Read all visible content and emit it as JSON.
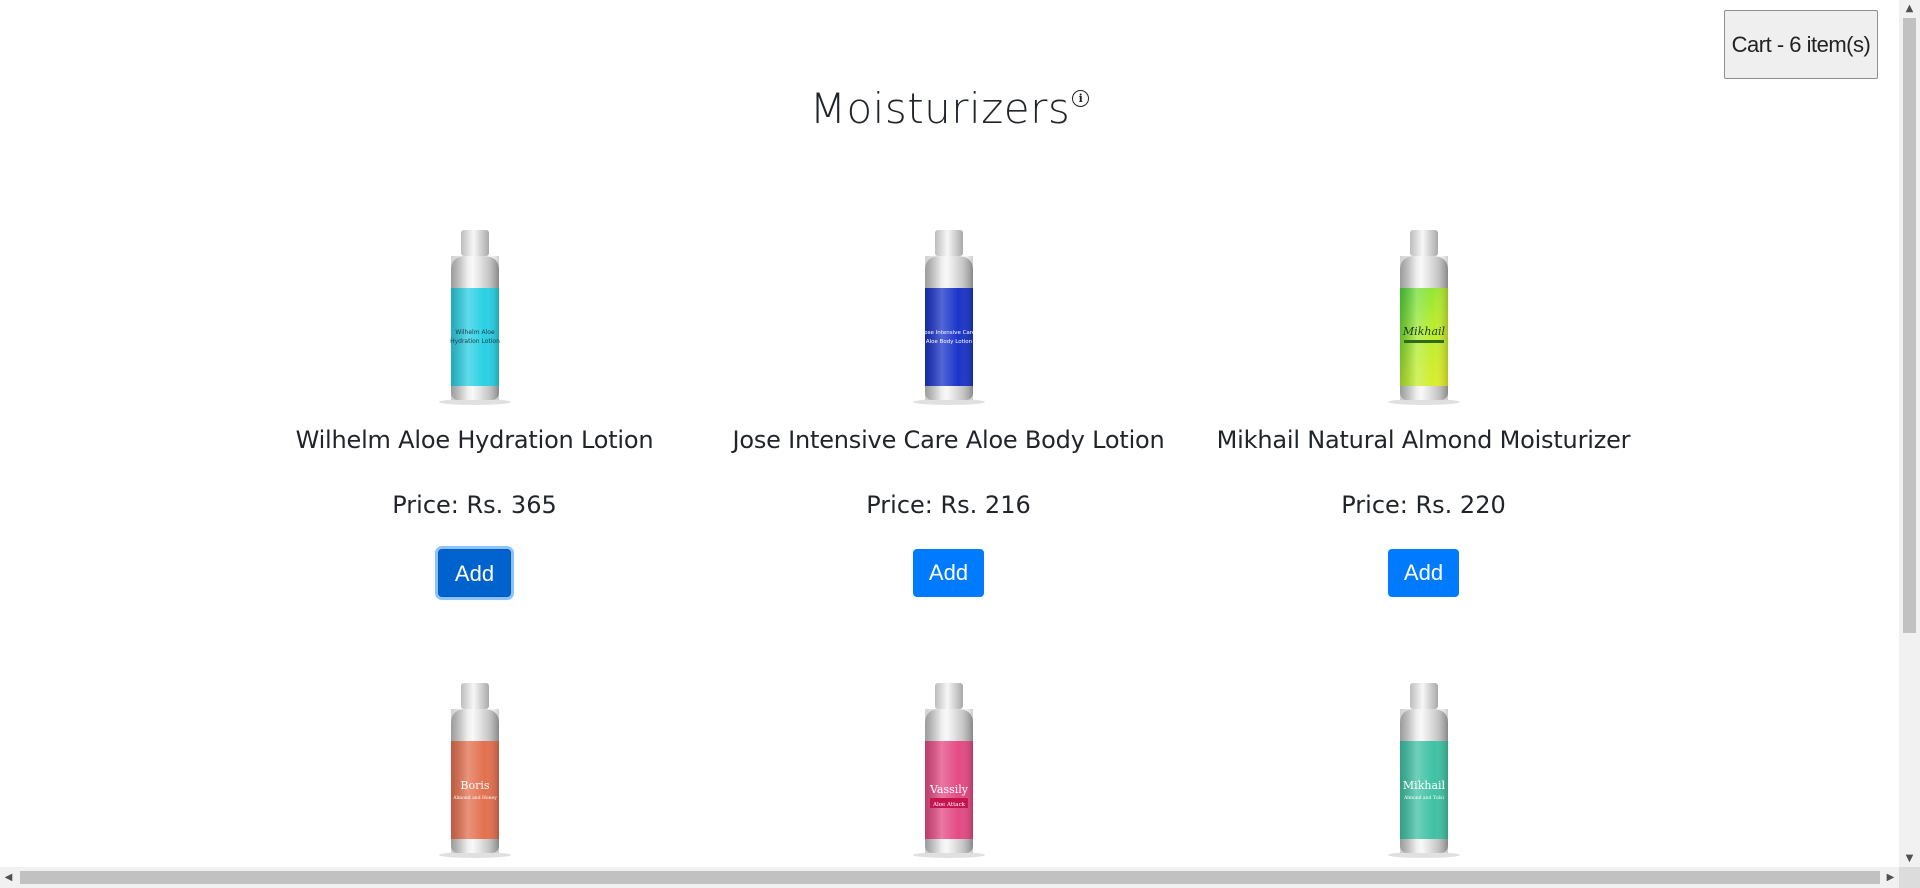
{
  "cart": {
    "label": "Cart - 6 item(s)"
  },
  "page": {
    "title": "Moisturizers",
    "info_icon": "info-icon"
  },
  "products": [
    {
      "name": "Wilhelm Aloe Hydration Lotion",
      "price": "Price: Rs. 365",
      "button": "Add",
      "label_line1": "Wilhelm Aloe",
      "label_line2": "Hydration Lotion",
      "color": "#2ad0e4"
    },
    {
      "name": "Jose Intensive Care Aloe Body Lotion",
      "price": "Price: Rs. 216",
      "button": "Add",
      "label_line1": "Jose Intensive Care",
      "label_line2": "Aloe Body Lotion",
      "color": "#1a34c8"
    },
    {
      "name": "Mikhail Natural Almond Moisturizer",
      "price": "Price: Rs. 220",
      "button": "Add",
      "label_line1": "Mikhail",
      "label_line2": "",
      "color": "#8be02c"
    },
    {
      "name": "",
      "price": "",
      "button": "",
      "label_line1": "Boris",
      "label_line2": "Almond and Honey",
      "color": "#e3704f"
    },
    {
      "name": "",
      "price": "",
      "button": "",
      "label_line1": "Vassily",
      "label_line2": "Aloe Attack",
      "color": "#e44a84"
    },
    {
      "name": "",
      "price": "",
      "button": "",
      "label_line1": "Mikhail",
      "label_line2": "Almond and Tulsi",
      "color": "#3fc2a4"
    }
  ]
}
